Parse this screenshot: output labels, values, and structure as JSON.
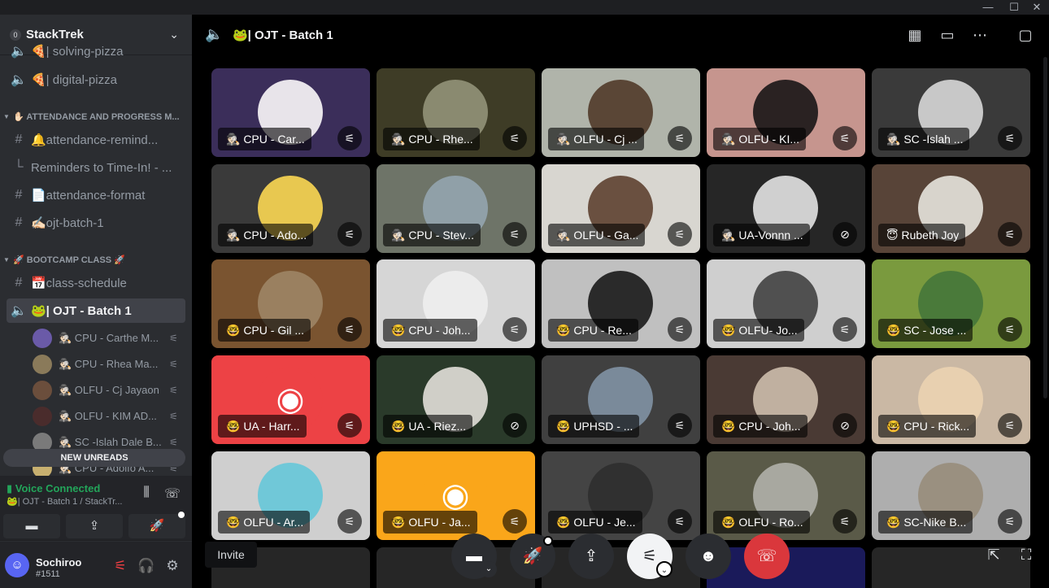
{
  "window_controls": {
    "minimize": "—",
    "maximize": "☐",
    "close": "✕"
  },
  "server": {
    "badge": "0",
    "name": "StackTrek"
  },
  "sidebar": {
    "channels": [
      {
        "icon": "speaker-icon",
        "glyph": "🔈",
        "label": "🍕| solving-pizza"
      },
      {
        "icon": "speaker-icon",
        "glyph": "🔈",
        "label": "🍕| digital-pizza"
      }
    ],
    "cat1": "✋🏻 ATTENDANCE AND PROGRESS M...",
    "cat1_channels": [
      {
        "glyph": "#",
        "label": "🔔attendance-remind..."
      },
      {
        "glyph": "└",
        "label": "Reminders to Time-In! - ..."
      },
      {
        "glyph": "#",
        "label": "📄attendance-format"
      },
      {
        "glyph": "#",
        "label": "✍🏻ojt-batch-1"
      }
    ],
    "cat2": "🚀 BOOTCAMP CLASS 🚀",
    "cat2_channels": [
      {
        "glyph": "#",
        "label": "📅class-schedule"
      },
      {
        "glyph": "🔈",
        "label": "🐸| OJT - Batch 1"
      }
    ],
    "voice_users": [
      {
        "name": "🕵🏻 CPU - Carthe M...",
        "color": "#6a5aa8"
      },
      {
        "name": "🕵🏻 CPU - Rhea Ma...",
        "color": "#8a7a5a"
      },
      {
        "name": "🕵🏻 OLFU - Cj Jayaon",
        "color": "#6b4e3c"
      },
      {
        "name": "🕵🏻 OLFU - KIM AD...",
        "color": "#4a2c2c"
      },
      {
        "name": "🕵🏻 SC -Islah Dale B...",
        "color": "#7a7a7a"
      },
      {
        "name": "🕵🏻 CPU - Adolfo A...",
        "color": "#c8b070"
      }
    ],
    "new_unreads": "NEW UNREADS"
  },
  "voice_panel": {
    "status": "Voice Connected",
    "channel": "🐸| OJT - Batch 1 / StackTr..."
  },
  "user": {
    "name": "Sochiroo",
    "tag": "#1511"
  },
  "stage": {
    "title": "🐸| OJT - Batch 1"
  },
  "tiles": [
    {
      "label": "🕵🏻 CPU - Car...",
      "bg": "#3b2e5a",
      "av": "#e8e4ea",
      "mic": "muted",
      "avatar": true
    },
    {
      "label": "🕵🏻 CPU - Rhe...",
      "bg": "#3e3c26",
      "av": "#8a8a70",
      "mic": "muted",
      "avatar": true
    },
    {
      "label": "🕵🏻 OLFU - Cj ...",
      "bg": "#b0b4aa",
      "av": "#5a4636",
      "mic": "muted",
      "avatar": true
    },
    {
      "label": "🕵🏻 OLFU - KI...",
      "bg": "#c6958e",
      "av": "#2a2222",
      "mic": "muted",
      "avatar": true
    },
    {
      "label": "🕵🏻 SC -Islah ...",
      "bg": "#3a3a3a",
      "av": "#c8c8c8",
      "mic": "muted",
      "avatar": true
    },
    {
      "label": "🕵🏻 CPU - Ado...",
      "bg": "#3a3a3a",
      "av": "#e8c850",
      "mic": "muted",
      "avatar": true
    },
    {
      "label": "🕵🏻 CPU - Stev...",
      "bg": "#6e7468",
      "av": "#90a0a8",
      "mic": "muted",
      "avatar": true
    },
    {
      "label": "🕵🏻 OLFU - Ga...",
      "bg": "#d8d6d0",
      "av": "#6a5040",
      "mic": "muted",
      "avatar": true
    },
    {
      "label": "🕵🏻 UA-Vonnn ...",
      "bg": "#262626",
      "av": "#d0d0d0",
      "mic": "deafened",
      "avatar": true
    },
    {
      "label": "😇 Rubeth Joy",
      "bg": "#584438",
      "av": "#d8d4cc",
      "mic": "muted",
      "avatar": true
    },
    {
      "label": "🤓 CPU - Gil ...",
      "bg": "#7a5430",
      "av": "#9a8060",
      "mic": "muted",
      "avatar": true
    },
    {
      "label": "🤓 CPU - Joh...",
      "bg": "#d6d6d6",
      "av": "#ececec",
      "mic": "muted",
      "avatar": true
    },
    {
      "label": "🤓 CPU - Re...",
      "bg": "#c0c0c0",
      "av": "#2a2a2a",
      "mic": "muted",
      "avatar": true
    },
    {
      "label": "🤓 OLFU- Jo...",
      "bg": "#cfcfcf",
      "av": "#505050",
      "mic": "muted",
      "avatar": true
    },
    {
      "label": "🤓 SC - Jose ...",
      "bg": "#7a9a3e",
      "av": "#4a7a3a",
      "mic": "muted",
      "avatar": true
    },
    {
      "label": "🤓 UA - Harr...",
      "bg": "#ed4245",
      "av": "#ed4245",
      "mic": "muted",
      "avatar": false,
      "discord": true
    },
    {
      "label": "🤓 UA - Riez...",
      "bg": "#2a3a2a",
      "av": "#d0cfc8",
      "mic": "deafened",
      "avatar": true
    },
    {
      "label": "🤓 UPHSD - ...",
      "bg": "#404040",
      "av": "#7a8a9a",
      "mic": "muted",
      "avatar": true
    },
    {
      "label": "🤓 CPU - Joh...",
      "bg": "#4a3a34",
      "av": "#c0b0a0",
      "mic": "deafened",
      "avatar": true
    },
    {
      "label": "🤓 CPU - Rick...",
      "bg": "#cab8a4",
      "av": "#e8d0b0",
      "mic": "muted",
      "avatar": true
    },
    {
      "label": "🤓 OLFU - Ar...",
      "bg": "#cfcfcf",
      "av": "#70c8d8",
      "mic": "muted",
      "avatar": true
    },
    {
      "label": "🤓 OLFU - Ja...",
      "bg": "#faa61a",
      "av": "#faa61a",
      "mic": "muted",
      "avatar": false,
      "discord": true
    },
    {
      "label": "🤓 OLFU - Je...",
      "bg": "#444444",
      "av": "#303030",
      "mic": "muted",
      "avatar": true
    },
    {
      "label": "🤓 OLFU - Ro...",
      "bg": "#5a5a48",
      "av": "#a8a8a0",
      "mic": "muted",
      "avatar": true
    },
    {
      "label": "🤓 SC-Nike B...",
      "bg": "#aeaeae",
      "av": "#9a9080",
      "mic": "muted",
      "avatar": true
    }
  ],
  "invite_tooltip": "Invite",
  "colors": {
    "accent": "#5865f2",
    "green": "#23a55a",
    "red": "#da373c"
  }
}
